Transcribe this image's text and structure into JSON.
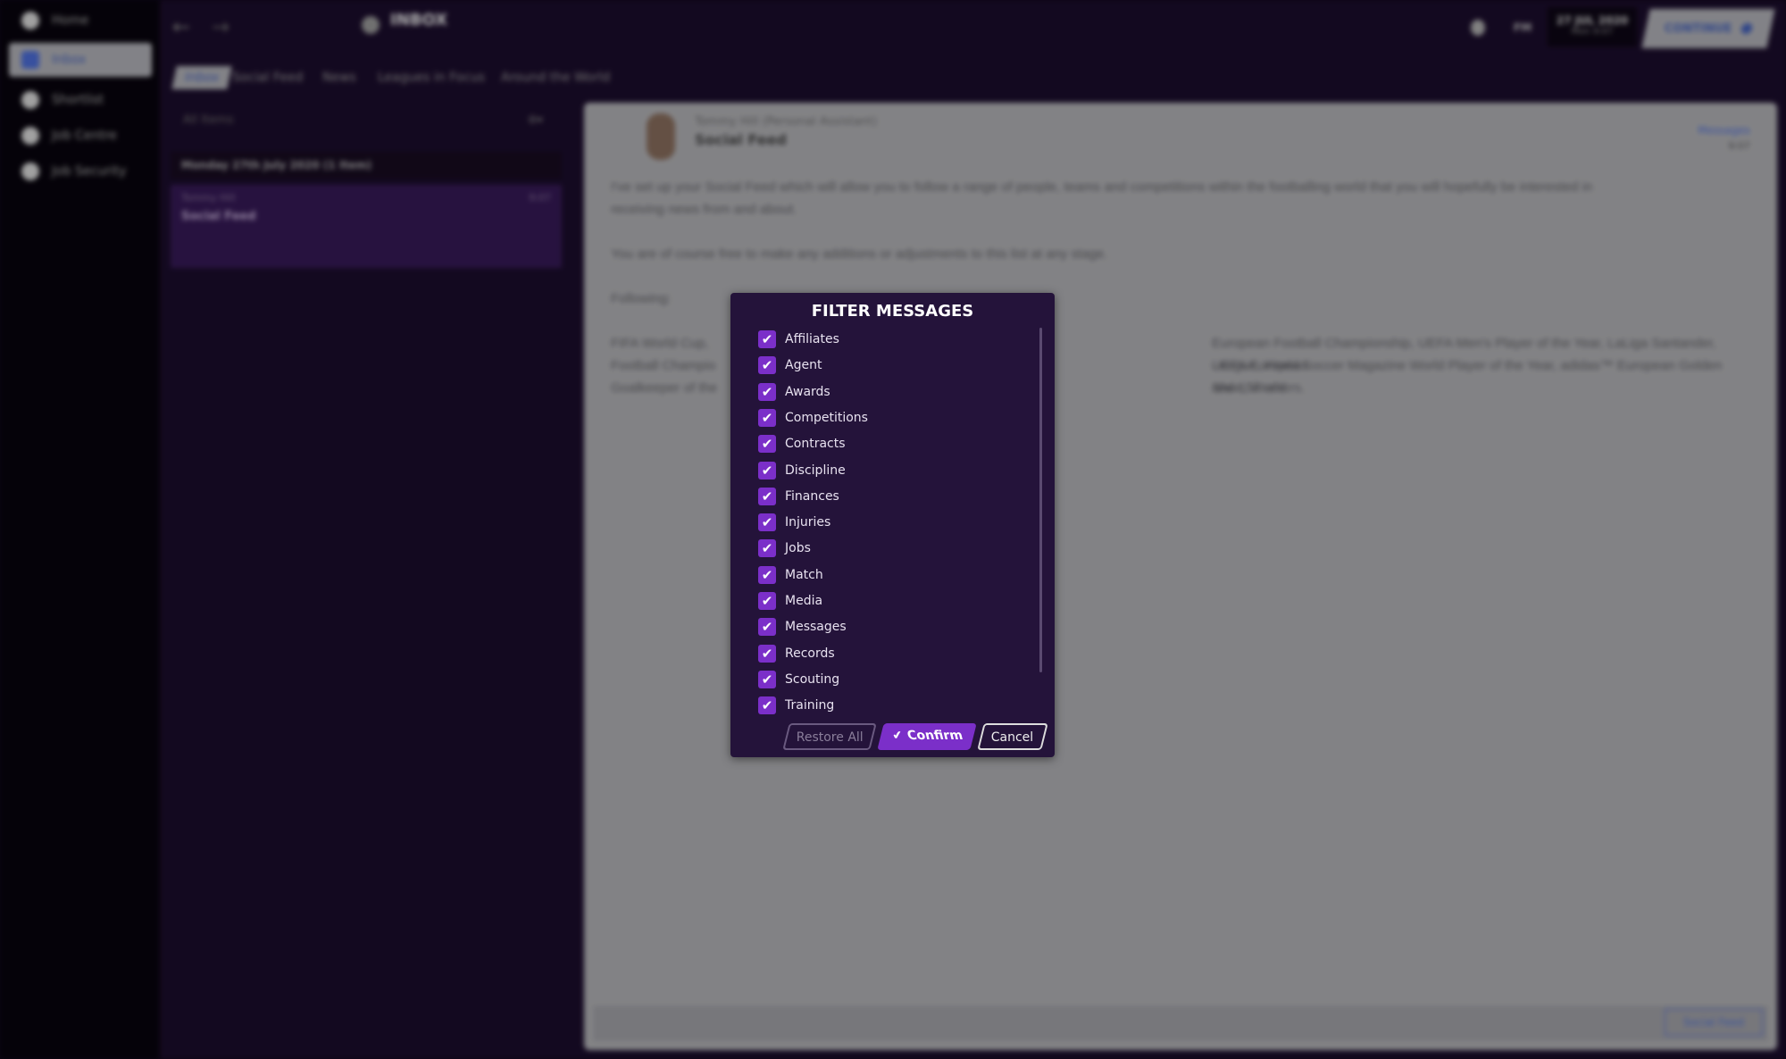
{
  "sidebar": {
    "items": [
      {
        "label": "Home"
      },
      {
        "label": "Inbox"
      },
      {
        "label": "Shortlist"
      },
      {
        "label": "Job Centre"
      },
      {
        "label": "Job Security"
      }
    ]
  },
  "header": {
    "title": "INBOX",
    "club": "FM",
    "date": "27 JUL 2020",
    "time": "Mon 9:07",
    "continue_label": "CONTINUE"
  },
  "tabs": [
    "Inbox",
    "Social Feed",
    "News",
    "Leagues in Focus",
    "Around the World"
  ],
  "list": {
    "search_placeholder": "All Items",
    "group": "Monday 27th July 2020 (1 Item)",
    "item": {
      "sender": "Tommy Hill",
      "time": "9:07",
      "subject": "Social Feed"
    }
  },
  "message": {
    "sender": "Tommy Hill (Personal Assistant)",
    "subject": "Social Feed",
    "category": "Messages",
    "time": "9:07",
    "p1a": "I've set up your Social Feed which will allow you to follow a range of people, teams and competitions within the footballing world that you will hopefully be interested in",
    "p1b": "receiving news from and about.",
    "p2": "You are of course free to make any additions or adjustments to this list at any stage.",
    "p3": "Following:",
    "f1a": "FIFA World Cup,",
    "f1b": "European Football Championship, UEFA Men's Player of the Year, LaLiga Santander, UEFA European",
    "f2a": "Football Champio",
    "f2b": "League, World Soccer Magazine World Player of the Year, adidas™ European Golden Shoe, World",
    "f3a": "Goalkeeper of the",
    "f3b": "and 157 others.",
    "footer_button": "Social Feed"
  },
  "dialog": {
    "title": "FILTER MESSAGES",
    "options": [
      {
        "label": "Affiliates",
        "checked": true
      },
      {
        "label": "Agent",
        "checked": true
      },
      {
        "label": "Awards",
        "checked": true
      },
      {
        "label": "Competitions",
        "checked": true
      },
      {
        "label": "Contracts",
        "checked": true
      },
      {
        "label": "Discipline",
        "checked": true
      },
      {
        "label": "Finances",
        "checked": true
      },
      {
        "label": "Injuries",
        "checked": true
      },
      {
        "label": "Jobs",
        "checked": true
      },
      {
        "label": "Match",
        "checked": true
      },
      {
        "label": "Media",
        "checked": true
      },
      {
        "label": "Messages",
        "checked": true
      },
      {
        "label": "Records",
        "checked": true
      },
      {
        "label": "Scouting",
        "checked": true
      },
      {
        "label": "Training",
        "checked": true
      }
    ],
    "restore_label": "Restore All",
    "confirm_label": "Confirm",
    "cancel_label": "Cancel",
    "check_glyph": "✔"
  },
  "colors": {
    "accent": "#7b2fc9",
    "dialog_bg": "#24133a"
  }
}
